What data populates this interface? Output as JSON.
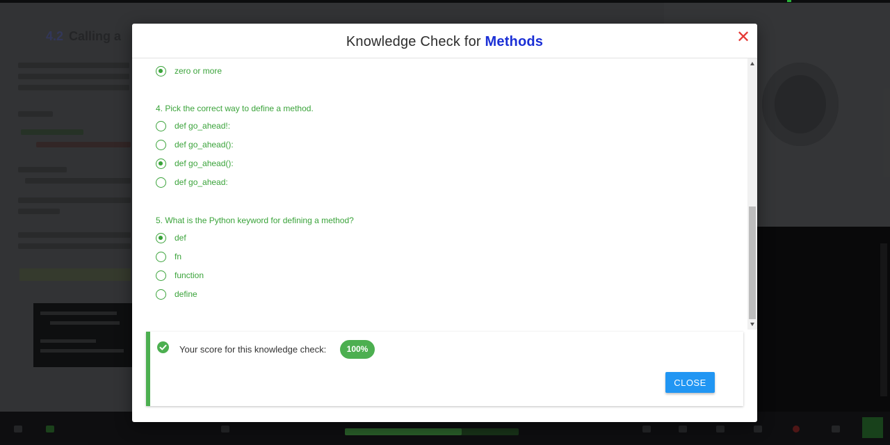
{
  "background": {
    "lesson_number": "4.2",
    "lesson_title": "Calling a"
  },
  "modal": {
    "title_prefix": "Knowledge Check for ",
    "title_topic": "Methods",
    "close_icon": "close-x-icon"
  },
  "questions": [
    {
      "text": "",
      "options": [
        {
          "label": "zero or more",
          "selected": true
        }
      ]
    },
    {
      "text": "4. Pick the correct way to define a method.",
      "options": [
        {
          "label": "def go_ahead!:",
          "selected": false
        },
        {
          "label": "def go_ahead():",
          "selected": false
        },
        {
          "label": "def go_ahead():",
          "selected": true
        },
        {
          "label": "def go_ahead:",
          "selected": false
        }
      ]
    },
    {
      "text": "5. What is the Python keyword for defining a method?",
      "options": [
        {
          "label": "def",
          "selected": true
        },
        {
          "label": "fn",
          "selected": false
        },
        {
          "label": "function",
          "selected": false
        },
        {
          "label": "define",
          "selected": false
        }
      ]
    }
  ],
  "score": {
    "text": "Your score for this knowledge check:",
    "value": "100%",
    "icon": "check-circle-icon"
  },
  "close_button": {
    "label": "CLOSE"
  },
  "colors": {
    "accent_green": "#3aa33a",
    "badge_green": "#4caf50",
    "topic_blue": "#1a2fd6",
    "close_red": "#e53935",
    "button_blue": "#2196f3"
  }
}
